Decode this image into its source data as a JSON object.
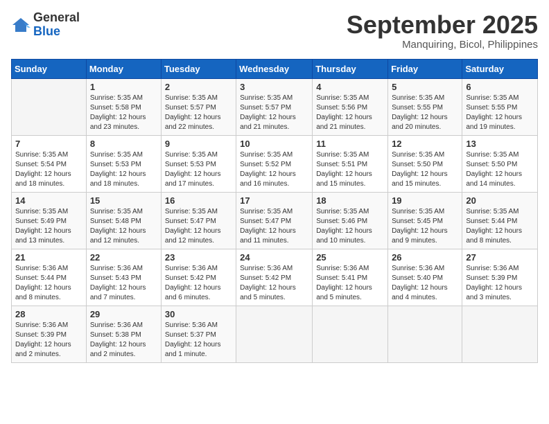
{
  "header": {
    "logo_general": "General",
    "logo_blue": "Blue",
    "month_title": "September 2025",
    "subtitle": "Manquiring, Bicol, Philippines"
  },
  "days_of_week": [
    "Sunday",
    "Monday",
    "Tuesday",
    "Wednesday",
    "Thursday",
    "Friday",
    "Saturday"
  ],
  "weeks": [
    [
      {
        "day": "",
        "detail": ""
      },
      {
        "day": "1",
        "detail": "Sunrise: 5:35 AM\nSunset: 5:58 PM\nDaylight: 12 hours\nand 23 minutes."
      },
      {
        "day": "2",
        "detail": "Sunrise: 5:35 AM\nSunset: 5:57 PM\nDaylight: 12 hours\nand 22 minutes."
      },
      {
        "day": "3",
        "detail": "Sunrise: 5:35 AM\nSunset: 5:57 PM\nDaylight: 12 hours\nand 21 minutes."
      },
      {
        "day": "4",
        "detail": "Sunrise: 5:35 AM\nSunset: 5:56 PM\nDaylight: 12 hours\nand 21 minutes."
      },
      {
        "day": "5",
        "detail": "Sunrise: 5:35 AM\nSunset: 5:55 PM\nDaylight: 12 hours\nand 20 minutes."
      },
      {
        "day": "6",
        "detail": "Sunrise: 5:35 AM\nSunset: 5:55 PM\nDaylight: 12 hours\nand 19 minutes."
      }
    ],
    [
      {
        "day": "7",
        "detail": "Sunrise: 5:35 AM\nSunset: 5:54 PM\nDaylight: 12 hours\nand 18 minutes."
      },
      {
        "day": "8",
        "detail": "Sunrise: 5:35 AM\nSunset: 5:53 PM\nDaylight: 12 hours\nand 18 minutes."
      },
      {
        "day": "9",
        "detail": "Sunrise: 5:35 AM\nSunset: 5:53 PM\nDaylight: 12 hours\nand 17 minutes."
      },
      {
        "day": "10",
        "detail": "Sunrise: 5:35 AM\nSunset: 5:52 PM\nDaylight: 12 hours\nand 16 minutes."
      },
      {
        "day": "11",
        "detail": "Sunrise: 5:35 AM\nSunset: 5:51 PM\nDaylight: 12 hours\nand 15 minutes."
      },
      {
        "day": "12",
        "detail": "Sunrise: 5:35 AM\nSunset: 5:50 PM\nDaylight: 12 hours\nand 15 minutes."
      },
      {
        "day": "13",
        "detail": "Sunrise: 5:35 AM\nSunset: 5:50 PM\nDaylight: 12 hours\nand 14 minutes."
      }
    ],
    [
      {
        "day": "14",
        "detail": "Sunrise: 5:35 AM\nSunset: 5:49 PM\nDaylight: 12 hours\nand 13 minutes."
      },
      {
        "day": "15",
        "detail": "Sunrise: 5:35 AM\nSunset: 5:48 PM\nDaylight: 12 hours\nand 12 minutes."
      },
      {
        "day": "16",
        "detail": "Sunrise: 5:35 AM\nSunset: 5:47 PM\nDaylight: 12 hours\nand 12 minutes."
      },
      {
        "day": "17",
        "detail": "Sunrise: 5:35 AM\nSunset: 5:47 PM\nDaylight: 12 hours\nand 11 minutes."
      },
      {
        "day": "18",
        "detail": "Sunrise: 5:35 AM\nSunset: 5:46 PM\nDaylight: 12 hours\nand 10 minutes."
      },
      {
        "day": "19",
        "detail": "Sunrise: 5:35 AM\nSunset: 5:45 PM\nDaylight: 12 hours\nand 9 minutes."
      },
      {
        "day": "20",
        "detail": "Sunrise: 5:35 AM\nSunset: 5:44 PM\nDaylight: 12 hours\nand 8 minutes."
      }
    ],
    [
      {
        "day": "21",
        "detail": "Sunrise: 5:36 AM\nSunset: 5:44 PM\nDaylight: 12 hours\nand 8 minutes."
      },
      {
        "day": "22",
        "detail": "Sunrise: 5:36 AM\nSunset: 5:43 PM\nDaylight: 12 hours\nand 7 minutes."
      },
      {
        "day": "23",
        "detail": "Sunrise: 5:36 AM\nSunset: 5:42 PM\nDaylight: 12 hours\nand 6 minutes."
      },
      {
        "day": "24",
        "detail": "Sunrise: 5:36 AM\nSunset: 5:42 PM\nDaylight: 12 hours\nand 5 minutes."
      },
      {
        "day": "25",
        "detail": "Sunrise: 5:36 AM\nSunset: 5:41 PM\nDaylight: 12 hours\nand 5 minutes."
      },
      {
        "day": "26",
        "detail": "Sunrise: 5:36 AM\nSunset: 5:40 PM\nDaylight: 12 hours\nand 4 minutes."
      },
      {
        "day": "27",
        "detail": "Sunrise: 5:36 AM\nSunset: 5:39 PM\nDaylight: 12 hours\nand 3 minutes."
      }
    ],
    [
      {
        "day": "28",
        "detail": "Sunrise: 5:36 AM\nSunset: 5:39 PM\nDaylight: 12 hours\nand 2 minutes."
      },
      {
        "day": "29",
        "detail": "Sunrise: 5:36 AM\nSunset: 5:38 PM\nDaylight: 12 hours\nand 2 minutes."
      },
      {
        "day": "30",
        "detail": "Sunrise: 5:36 AM\nSunset: 5:37 PM\nDaylight: 12 hours\nand 1 minute."
      },
      {
        "day": "",
        "detail": ""
      },
      {
        "day": "",
        "detail": ""
      },
      {
        "day": "",
        "detail": ""
      },
      {
        "day": "",
        "detail": ""
      }
    ]
  ]
}
